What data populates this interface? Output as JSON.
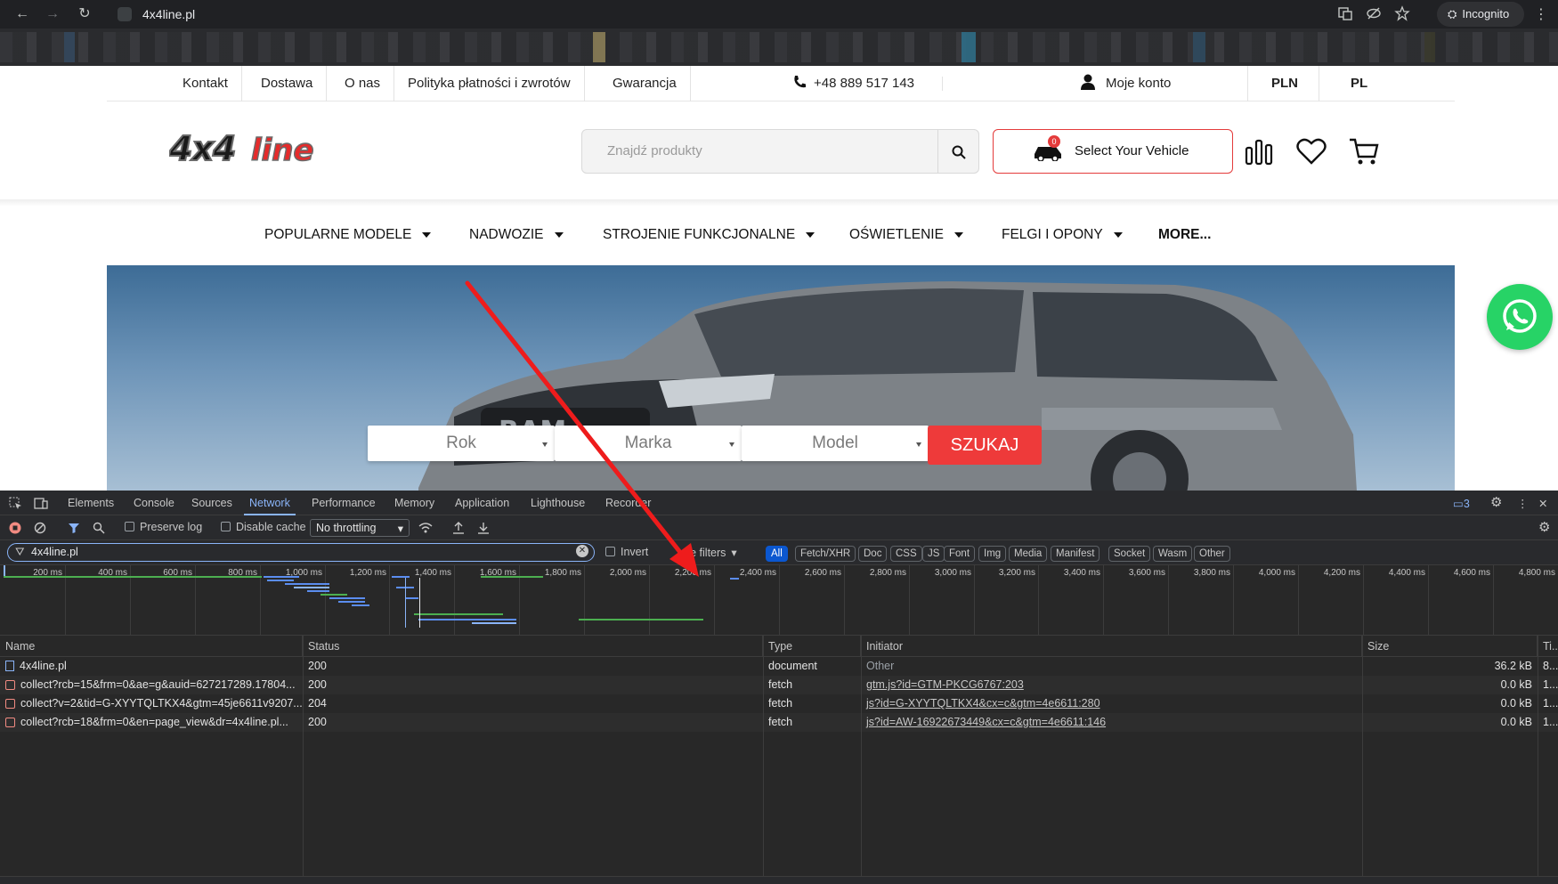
{
  "browser": {
    "url": "4x4line.pl",
    "profile_label": "Incognito",
    "nav": {
      "back": "←",
      "forward": "→",
      "reload": "↻"
    }
  },
  "site": {
    "top_links": [
      "Kontakt",
      "Dostawa",
      "O nas",
      "Polityka płatności i zwrotów",
      "Gwarancja"
    ],
    "phone": "+48 889 517 143",
    "account": "Moje konto",
    "currency": "PLN",
    "language": "PL",
    "search_placeholder": "Znajdź produkty",
    "vehicle_button": "Select Your Vehicle",
    "vehicle_badge": "0",
    "main_nav": [
      "POPULARNE MODELE",
      "NADWOZIE",
      "STROJENIE FUNKCJONALNE",
      "OŚWIETLENIE",
      "FELGI I OPONY",
      "MORE..."
    ],
    "hero": {
      "selects": [
        "Rok",
        "Marka",
        "Model"
      ],
      "search_button": "SZUKAJ"
    },
    "colors": {
      "accent": "#ee3a3a",
      "whatsapp": "#27d366"
    }
  },
  "devtools": {
    "tabs": [
      "Elements",
      "Console",
      "Sources",
      "Network",
      "Performance",
      "Memory",
      "Application",
      "Lighthouse",
      "Recorder"
    ],
    "active_tab": "Network",
    "issues_count": "3",
    "toolbar": {
      "preserve_log": "Preserve log",
      "disable_cache": "Disable cache",
      "throttling": "No throttling"
    },
    "filter": {
      "value": "4x4line.pl",
      "invert": "Invert",
      "more_filters": "ore filters",
      "chips": [
        "All",
        "Fetch/XHR",
        "Doc",
        "CSS",
        "JS",
        "Font",
        "Img",
        "Media",
        "Manifest",
        "Socket",
        "Wasm",
        "Other"
      ]
    },
    "timeline_ticks": [
      "200 ms",
      "400 ms",
      "600 ms",
      "800 ms",
      "1,000 ms",
      "1,200 ms",
      "1,400 ms",
      "1,600 ms",
      "1,800 ms",
      "2,000 ms",
      "2,200 ms",
      "2,400 ms",
      "2,600 ms",
      "2,800 ms",
      "3,000 ms",
      "3,200 ms",
      "3,400 ms",
      "3,600 ms",
      "3,800 ms",
      "4,000 ms",
      "4,200 ms",
      "4,400 ms",
      "4,600 ms",
      "4,800 ms"
    ],
    "columns": [
      "Name",
      "Status",
      "Type",
      "Initiator",
      "Size",
      "Ti..."
    ],
    "rows": [
      {
        "name": "4x4line.pl",
        "status": "200",
        "type": "document",
        "initiator": "Other",
        "size": "36.2 kB",
        "time": "8..."
      },
      {
        "name": "collect?rcb=15&frm=0&ae=g&auid=627217289.17804...",
        "status": "200",
        "type": "fetch",
        "initiator": "gtm.js?id=GTM-PKCG6767:203",
        "size": "0.0 kB",
        "time": "1..."
      },
      {
        "name": "collect?v=2&tid=G-XYYTQLTKX4&gtm=45je6611v9207...",
        "status": "204",
        "type": "fetch",
        "initiator": "js?id=G-XYYTQLTKX4&cx=c&gtm=4e6611:280",
        "size": "0.0 kB",
        "time": "1..."
      },
      {
        "name": "collect?rcb=18&frm=0&en=page_view&dr=4x4line.pl...",
        "status": "200",
        "type": "fetch",
        "initiator": "js?id=AW-16922673449&cx=c&gtm=4e6611:146",
        "size": "0.0 kB",
        "time": "1..."
      }
    ]
  }
}
